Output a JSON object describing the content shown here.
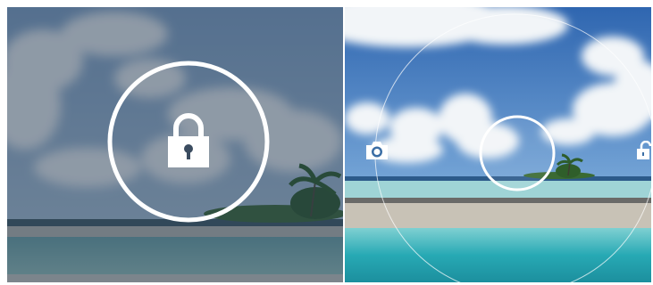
{
  "screens": [
    {
      "name": "locked-state",
      "dimmed": true,
      "icon": "lock-closed-icon",
      "colors": {
        "sky_top": "#5b7a9e",
        "sea": "#4f7c86",
        "sand": "#9aa0a2"
      }
    },
    {
      "name": "unlock-ring-state",
      "dimmed": false,
      "targets": [
        {
          "name": "camera-target",
          "icon": "camera-icon"
        },
        {
          "name": "unlock-target",
          "icon": "lock-open-icon"
        }
      ],
      "handle": "center-handle",
      "colors": {
        "sky_top": "#3e74b8",
        "sea": "#2aa8b5",
        "sand": "#b8b3a8"
      }
    }
  ]
}
